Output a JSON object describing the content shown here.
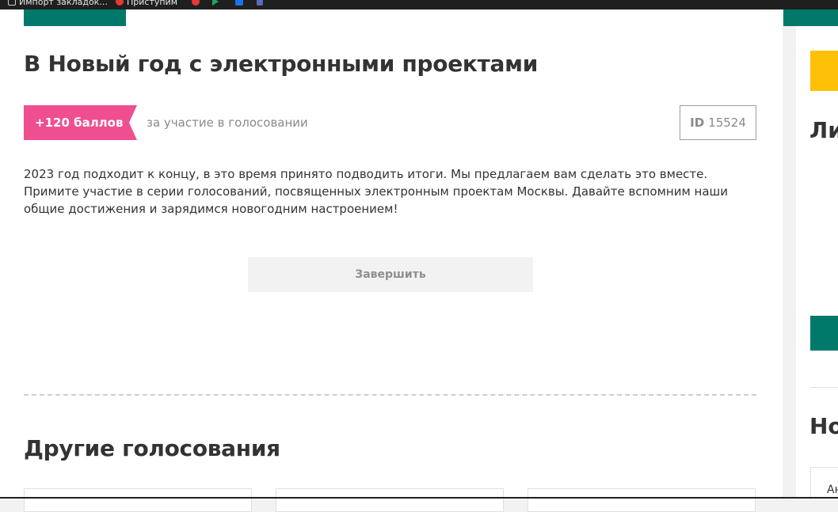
{
  "bookmarks": [
    {
      "label": "Импорт закладок...",
      "icon": "bookmark-folder-icon"
    },
    {
      "label": "Приступим",
      "icon": "opera-icon"
    },
    {
      "label": "",
      "icon": "yandex-icon"
    },
    {
      "label": "",
      "icon": "play-icon"
    },
    {
      "label": "",
      "icon": "blue-square-icon"
    },
    {
      "label": "",
      "icon": "app-icon"
    }
  ],
  "poll": {
    "title": "В Новый год с электронными проектами",
    "points_badge": "+120 баллов",
    "points_caption": "за участие в голосовании",
    "id_label": "ID",
    "id_value": "15524",
    "description": "2023 год подходит к концу, в это время принято подводить итоги. Мы предлагаем вам сделать это вместе. Примите участие в серии голосований, посвященных электронным проектам Москвы. Давайте вспомним наши общие достижения и зарядимся новогодним настроением!",
    "finish_button": "Завершить"
  },
  "other_polls": {
    "title": "Другие голосования"
  },
  "sidebar": {
    "heading_1": "Ли",
    "heading_2": "Но",
    "card_text": "Ан"
  },
  "colors": {
    "accent_teal": "#00796b",
    "badge_pink": "#ef4f91",
    "yellow": "#ffc107"
  }
}
